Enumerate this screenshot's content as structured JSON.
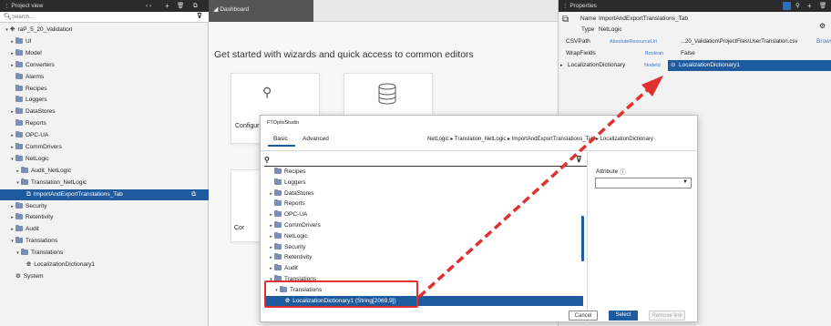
{
  "project_view": {
    "title": "Project view",
    "search_placeholder": "Search...",
    "items": [
      {
        "label": "raP_5_20_Validation",
        "depth": 0,
        "arrow": "▾",
        "icon": "project"
      },
      {
        "label": "UI",
        "depth": 1,
        "arrow": "▸",
        "icon": "folder"
      },
      {
        "label": "Model",
        "depth": 1,
        "arrow": "▸",
        "icon": "folder"
      },
      {
        "label": "Converters",
        "depth": 1,
        "arrow": "▸",
        "icon": "folder"
      },
      {
        "label": "Alarms",
        "depth": 1,
        "arrow": "",
        "icon": "folder"
      },
      {
        "label": "Recipes",
        "depth": 1,
        "arrow": "",
        "icon": "folder"
      },
      {
        "label": "Loggers",
        "depth": 1,
        "arrow": "",
        "icon": "folder"
      },
      {
        "label": "DataStores",
        "depth": 1,
        "arrow": "▸",
        "icon": "folder"
      },
      {
        "label": "Reports",
        "depth": 1,
        "arrow": "",
        "icon": "folder"
      },
      {
        "label": "OPC-UA",
        "depth": 1,
        "arrow": "▸",
        "icon": "folder"
      },
      {
        "label": "CommDrivers",
        "depth": 1,
        "arrow": "▸",
        "icon": "folder"
      },
      {
        "label": "NetLogic",
        "depth": 1,
        "arrow": "▾",
        "icon": "folder"
      },
      {
        "label": "Audit_NetLogic",
        "depth": 2,
        "arrow": "▸",
        "icon": "folder"
      },
      {
        "label": "Translation_NetLogic",
        "depth": 2,
        "arrow": "▾",
        "icon": "folder"
      },
      {
        "label": "ImportAndExportTranslations_Tab",
        "depth": 3,
        "arrow": "",
        "icon": "netlogic",
        "selected": true
      },
      {
        "label": "Security",
        "depth": 1,
        "arrow": "▸",
        "icon": "folder"
      },
      {
        "label": "Retentivity",
        "depth": 1,
        "arrow": "▸",
        "icon": "folder"
      },
      {
        "label": "Audit",
        "depth": 1,
        "arrow": "▸",
        "icon": "folder"
      },
      {
        "label": "Translations",
        "depth": 1,
        "arrow": "▾",
        "icon": "folder"
      },
      {
        "label": "Translations",
        "depth": 2,
        "arrow": "▾",
        "icon": "folder"
      },
      {
        "label": "LocalizationDictionary1",
        "depth": 3,
        "arrow": "",
        "icon": "globe"
      },
      {
        "label": "System",
        "depth": 1,
        "arrow": "",
        "icon": "gear"
      }
    ]
  },
  "dashboard": {
    "tab_label": "Dashboard",
    "heading": "Get started with wizards and quick access to common editors",
    "card1_label": "Configur",
    "card3_label": "Cor"
  },
  "properties": {
    "title": "Properties",
    "name_label": "Name",
    "name_value": "ImportAndExportTranslations_Tab",
    "type_label": "Type",
    "type_value": "NetLogic",
    "rows": [
      {
        "name": "CSVPath",
        "type": "AbsoluteResourceUri",
        "value": "...20_Validation\\ProjectFiles\\UserTranslation.csv",
        "extra": "Browse"
      },
      {
        "name": "WrapFields",
        "type": "Boolean",
        "value": "False",
        "extra": ""
      },
      {
        "name": "LocalizationDictionary",
        "type": "NodeId",
        "value": "LocalizationDictionary1",
        "extra": ""
      }
    ]
  },
  "dialog": {
    "app_name": "FTOptixStudio",
    "tab_basic": "Basic",
    "tab_advanced": "Advanced",
    "breadcrumb": "NetLogic ▸ Translation_NetLogic ▸ ImportAndExportTranslations_Tab ▸ LocalizationDictionary",
    "attribute_label": "Attribute",
    "items": [
      {
        "label": "Recipes",
        "depth": 0,
        "arrow": "",
        "icon": "folder"
      },
      {
        "label": "Loggers",
        "depth": 0,
        "arrow": "",
        "icon": "folder"
      },
      {
        "label": "DataStores",
        "depth": 0,
        "arrow": "▸",
        "icon": "folder"
      },
      {
        "label": "Reports",
        "depth": 0,
        "arrow": "",
        "icon": "folder"
      },
      {
        "label": "OPC-UA",
        "depth": 0,
        "arrow": "▸",
        "icon": "folder"
      },
      {
        "label": "CommDrivers",
        "depth": 0,
        "arrow": "▸",
        "icon": "folder"
      },
      {
        "label": "NetLogic",
        "depth": 0,
        "arrow": "▸",
        "icon": "folder"
      },
      {
        "label": "Security",
        "depth": 0,
        "arrow": "▸",
        "icon": "folder"
      },
      {
        "label": "Retentivity",
        "depth": 0,
        "arrow": "▸",
        "icon": "folder"
      },
      {
        "label": "Audit",
        "depth": 0,
        "arrow": "▸",
        "icon": "folder"
      },
      {
        "label": "Translations",
        "depth": 0,
        "arrow": "▾",
        "icon": "folder"
      },
      {
        "label": "Translations",
        "depth": 1,
        "arrow": "▾",
        "icon": "folder"
      },
      {
        "label": "LocalizationDictionary1 (String[2069,9])",
        "depth": 2,
        "arrow": "",
        "icon": "globe",
        "selected": true
      }
    ],
    "cancel_label": "Cancel",
    "select_label": "Select",
    "remove_label": "Remove link"
  },
  "colors": {
    "accent": "#1e5a9e",
    "highlight_box": "#e03030",
    "arrow": "#e03030"
  }
}
